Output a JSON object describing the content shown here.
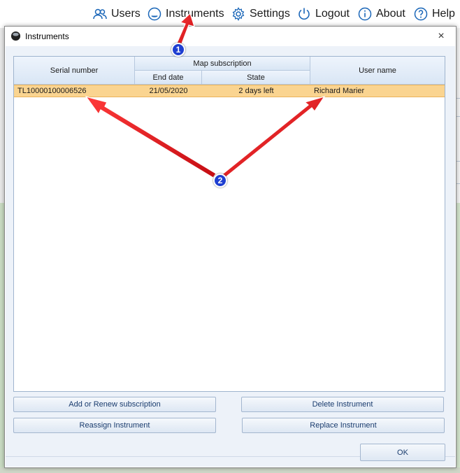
{
  "topnav": {
    "items": [
      {
        "label": "Users",
        "icon": "users-icon"
      },
      {
        "label": "Instruments",
        "icon": "instrument-icon"
      },
      {
        "label": "Settings",
        "icon": "gear-icon"
      },
      {
        "label": "Logout",
        "icon": "power-icon"
      },
      {
        "label": "About",
        "icon": "info-icon"
      },
      {
        "label": "Help",
        "icon": "help-icon"
      }
    ]
  },
  "dialog": {
    "title": "Instruments",
    "close_label": "×",
    "grid": {
      "headers": {
        "serial": "Serial number",
        "map_subscription": "Map subscription",
        "end_date": "End date",
        "state": "State",
        "user": "User name"
      },
      "rows": [
        {
          "serial": "TL10000100006526",
          "end_date": "21/05/2020",
          "state": "2 days left",
          "user": "Richard Marier"
        }
      ]
    },
    "buttons": {
      "add_renew": "Add or Renew subscription",
      "delete": "Delete Instrument",
      "reassign": "Reassign Instrument",
      "replace": "Replace Instrument",
      "ok": "OK"
    }
  },
  "annotations": {
    "badge1": "1",
    "badge2": "2",
    "arrow_color": "#e8141b",
    "badge_color": "#1f3fd1"
  },
  "colors": {
    "selected_row": "#fad490",
    "header_gradient_top": "#eef4fc",
    "header_gradient_bottom": "#d9e6f5",
    "dialog_content_bg": "#edf2f9",
    "nav_icon": "#1a66b8"
  }
}
